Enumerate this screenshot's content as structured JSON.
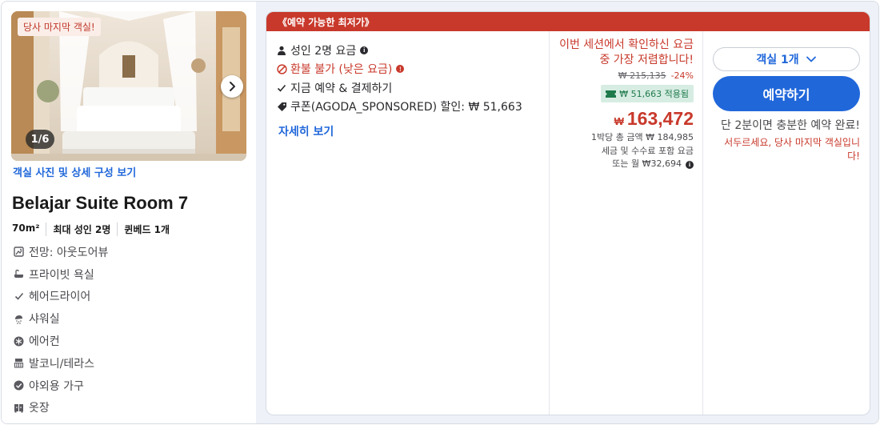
{
  "left": {
    "last_room_badge": "당사 마지막 객실!",
    "photo_counter": "1/6",
    "photo_link": "객실 사진 및 상세 구성 보기",
    "room_name": "Belajar Suite Room 7",
    "specs": [
      "70m²",
      "최대 성인 2명",
      "퀸베드 1개"
    ],
    "amenities": [
      {
        "icon": "view-icon",
        "label": "전망: 아웃도어뷰"
      },
      {
        "icon": "bathtub-icon",
        "label": "프라이빗 욕실"
      },
      {
        "icon": "check-icon",
        "label": "헤어드라이어"
      },
      {
        "icon": "shower-icon",
        "label": "샤워실"
      },
      {
        "icon": "snowflake-icon",
        "label": "에어컨"
      },
      {
        "icon": "balcony-icon",
        "label": "발코니/테라스"
      },
      {
        "icon": "check-circle-icon",
        "label": "야외용 가구"
      },
      {
        "icon": "wardrobe-icon",
        "label": "옷장"
      }
    ]
  },
  "offer": {
    "header": "《예약 가능한 최저가》",
    "features": {
      "adults": "성인 2명 요금",
      "nonrefundable": "환불 불가 (낮은 요금)",
      "pay_now": "지금 예약 & 결제하기",
      "coupon": "쿠폰(AGODA_SPONSORED) 할인: ₩ 51,663"
    },
    "detail_link": "자세히 보기",
    "price": {
      "cheapest_notice": "이번 세션에서 확인하신 요금 중 가장 저렴합니다!",
      "original": "₩ 215,135",
      "discount_pct": "-24%",
      "coupon_applied": "₩ 51,663 적용됨",
      "currency": "₩",
      "amount": "163,472",
      "sub_total": "1박당 총 금액 ₩ 184,985",
      "sub_tax": "세금 및 수수료 포함 요금",
      "sub_monthly": "또는 월 ₩32,694"
    },
    "booking": {
      "room_count": "객실 1개",
      "book_button": "예약하기",
      "quick_notice": "단 2분이면 충분한 예약 완료!",
      "hurry_notice": "서두르세요, 당사 마지막 객실입니다!"
    }
  },
  "colors": {
    "accent_blue": "#2067da",
    "alert_red": "#c8392b",
    "coupon_green": "#1f7a4c"
  }
}
